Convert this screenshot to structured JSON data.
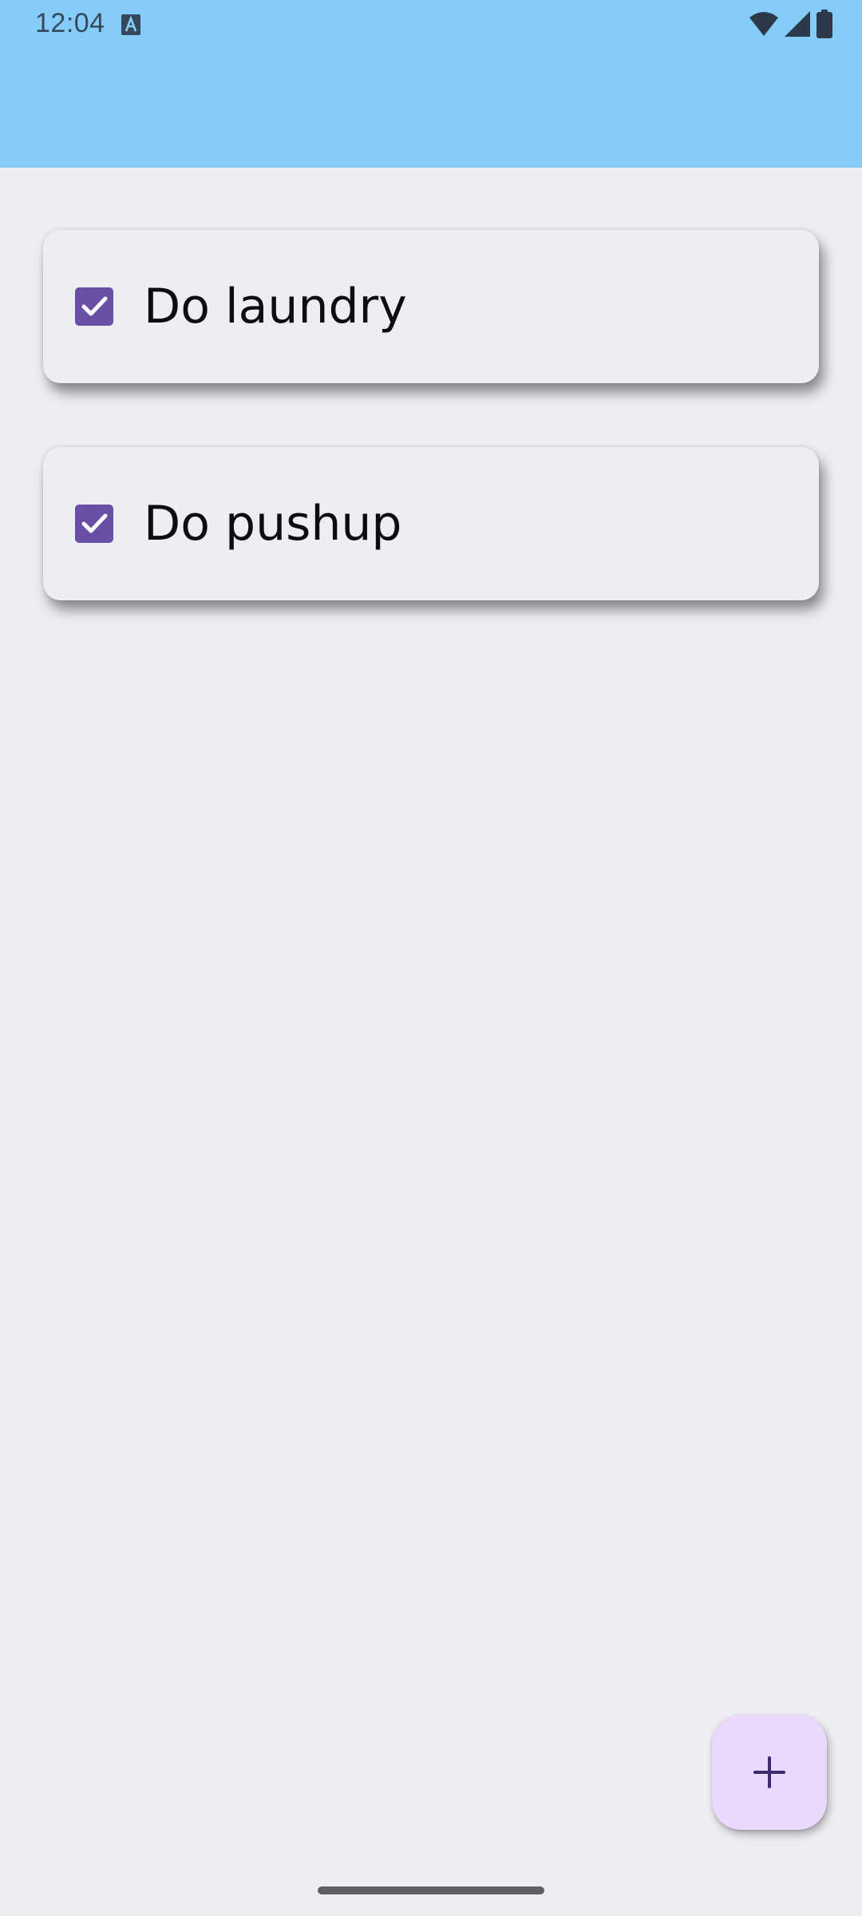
{
  "status_bar": {
    "time": "12:04",
    "icons": [
      "text-a-icon",
      "wifi-icon",
      "signal-icon",
      "battery-icon"
    ]
  },
  "header": {
    "background_color": "#86ccf8"
  },
  "tasks": [
    {
      "label": "Do laundry",
      "checked": true
    },
    {
      "label": "Do pushup",
      "checked": true
    }
  ],
  "colors": {
    "checkbox": "#6b4fa7",
    "fab_background": "#ead9fc",
    "fab_icon": "#3e2a6f",
    "page_background": "#edeef4"
  },
  "fab": {
    "icon": "plus-icon"
  }
}
